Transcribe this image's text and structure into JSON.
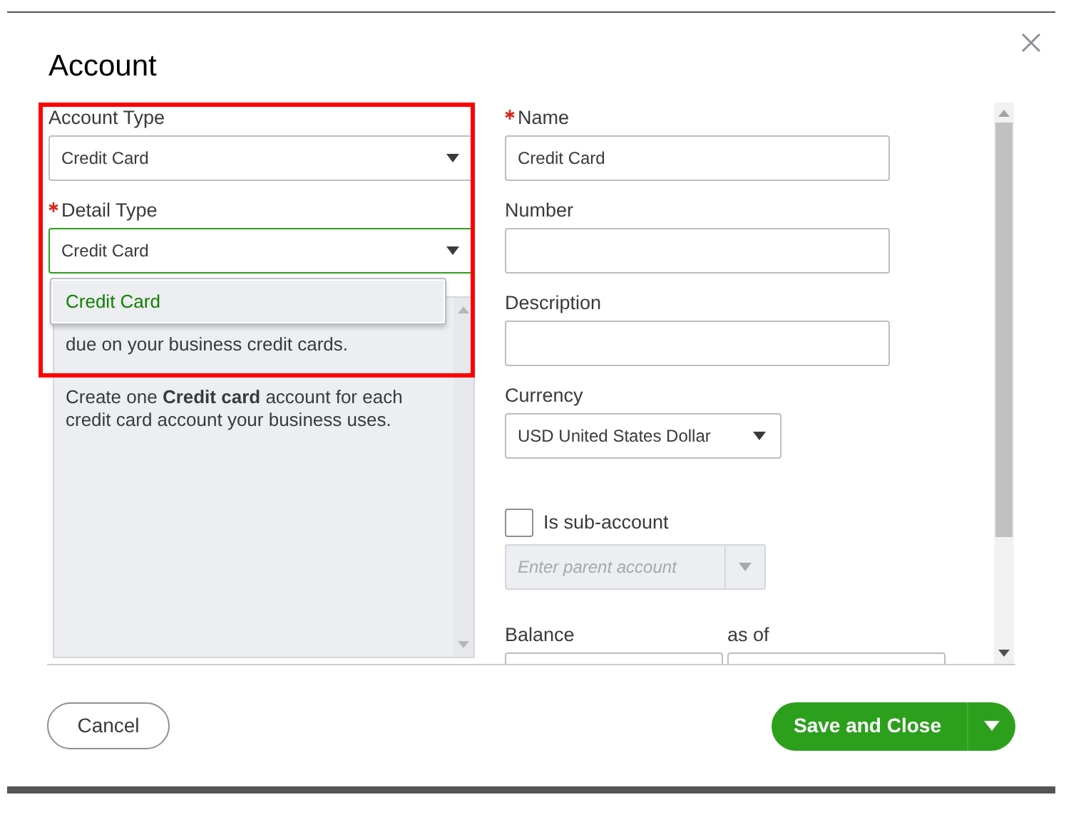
{
  "dialog": {
    "title": "Account"
  },
  "account_type": {
    "label": "Account Type",
    "value": "Credit Card",
    "focused": false
  },
  "detail_type": {
    "label": "Detail Type",
    "required": true,
    "value": "Credit Card",
    "focused": true
  },
  "detail_type_menu": {
    "items": [
      {
        "label": "Credit Card",
        "selected": true
      }
    ]
  },
  "description_panel": {
    "paragraphs": [
      "due on your business credit cards.",
      "Create one **Credit card** account for each credit card account your business uses."
    ]
  },
  "name": {
    "label": "Name",
    "required": true,
    "value": "Credit Card"
  },
  "number": {
    "label": "Number"
  },
  "description": {
    "label": "Description"
  },
  "currency": {
    "label": "Currency",
    "value": "USD United States Dollar"
  },
  "sub_account": {
    "label": "Is sub-account",
    "checked": false,
    "placeholder": "Enter parent account"
  },
  "balance": {
    "label": "Balance"
  },
  "as_of": {
    "label": "as of"
  },
  "buttons": {
    "cancel": "Cancel",
    "save": "Save and Close"
  }
}
